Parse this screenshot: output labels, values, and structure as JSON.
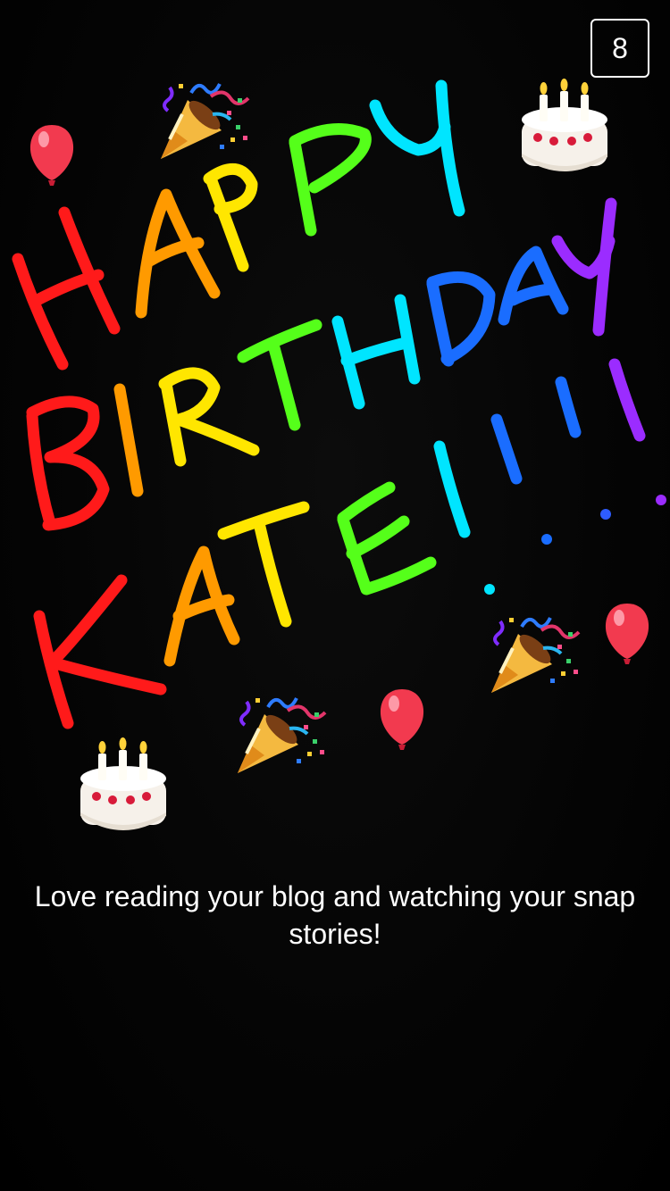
{
  "snap": {
    "timer": "8",
    "caption": "Love reading your blog and watching your snap stories!",
    "drawing_text": [
      "HAPPY",
      "BIRTHDAY",
      "KATE!!!!"
    ],
    "stickers": [
      "balloon-icon",
      "party-popper-icon",
      "birthday-cake-icon"
    ]
  },
  "colors": {
    "background": "#000000",
    "text": "#ffffff",
    "rainbow": [
      "#ff1a1a",
      "#ff9a00",
      "#ffe600",
      "#55ff1a",
      "#00e5ff",
      "#1a6dff",
      "#9b2cff"
    ]
  }
}
